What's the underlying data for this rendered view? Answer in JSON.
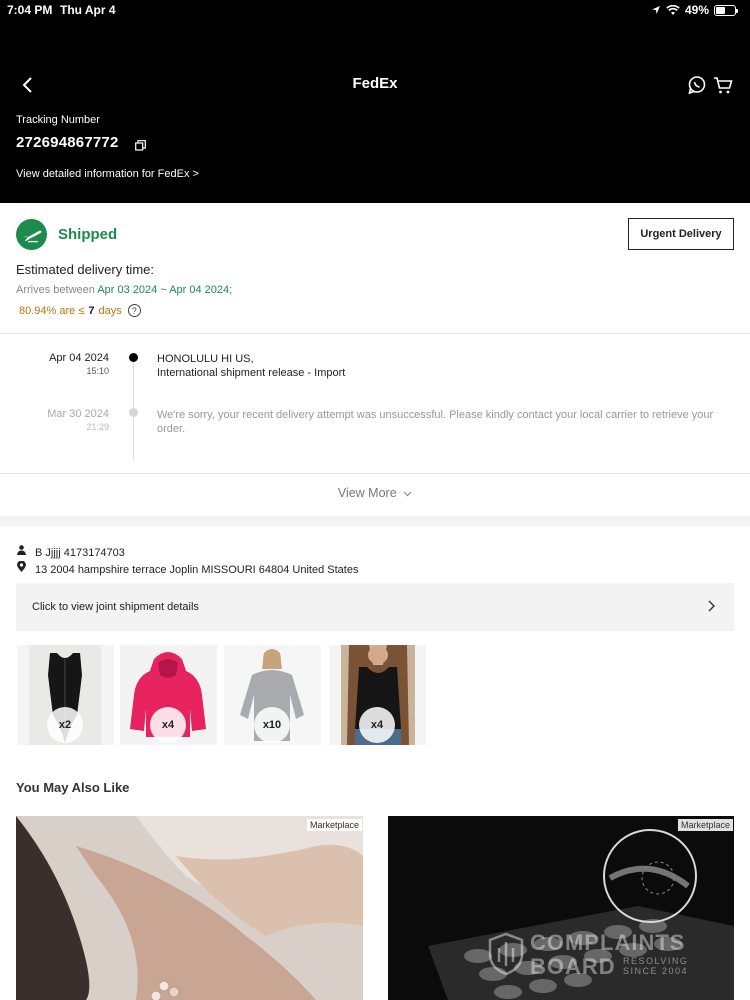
{
  "status_bar": {
    "time": "7:04 PM",
    "date": "Thu Apr 4",
    "battery": "49%"
  },
  "nav": {
    "title": "FedEx",
    "back_icon": "chevron-left-icon",
    "share_icon": "whatsapp-icon",
    "cart_icon": "cart-icon"
  },
  "tracking": {
    "label": "Tracking Number",
    "number": "272694867772",
    "detail_link": "View detailed information for FedEx >"
  },
  "shipment": {
    "status": "Shipped",
    "status_color": "#1d8a4e",
    "urgent_button": "Urgent Delivery",
    "eta_title": "Estimated delivery time:",
    "arrives_prefix": "Arrives between",
    "arrives_range": "Apr 03 2024 ~ Apr 04 2024;",
    "percent_prefix": "80.94% are ≤",
    "percent_days": "7",
    "percent_suffix": "days"
  },
  "timeline": [
    {
      "date": "Apr 04 2024",
      "time": "15:10",
      "line1": "HONOLULU HI US,",
      "line2": "International shipment release - Import",
      "active": true
    },
    {
      "date": "Mar 30 2024",
      "time": "21:29",
      "line1": "We're sorry, your recent delivery attempt was unsuccessful. Please kindly contact your local carrier to retrieve your",
      "line2": "order.",
      "active": false
    }
  ],
  "view_more": "View More",
  "recipient": {
    "name_phone": "B Jjjjj 4173174703",
    "address": "13 2004 hampshire terrace Joplin MISSOURI 64804 United States"
  },
  "joint_shipment": {
    "label": "Click to view joint shipment details"
  },
  "items": [
    {
      "qty": "x2",
      "name": "bodysuit"
    },
    {
      "qty": "x4",
      "name": "pink-hoodie"
    },
    {
      "qty": "x10",
      "name": "grey-sweatshirt"
    },
    {
      "qty": "x4",
      "name": "black-tank"
    }
  ],
  "you_may_also_like": {
    "title": "You May Also Like",
    "cards": [
      {
        "tag": "Marketplace"
      },
      {
        "tag": "Marketplace"
      }
    ]
  },
  "watermark": {
    "line1": "COMPLAINTS",
    "line2": "BOARD",
    "sub1": "RESOLVING",
    "sub2": "SINCE 2004"
  }
}
